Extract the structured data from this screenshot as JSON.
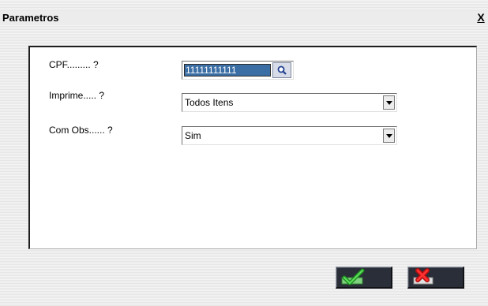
{
  "window": {
    "title": "Parametros",
    "close_glyph": "X"
  },
  "form": {
    "cpf": {
      "label": "CPF......... ?",
      "value": "11111111111"
    },
    "imprime": {
      "label": "Imprime..... ?",
      "selected": "Todos Itens"
    },
    "com_obs": {
      "label": "Com Obs...... ?",
      "selected": "Sim"
    }
  },
  "icons": {
    "lookup": "magnifier-icon",
    "confirm": "checkmark-icon",
    "cancel": "red-x-icon",
    "dropdown": "chevron-down-icon"
  },
  "colors": {
    "selection_bg": "#3b6ea5",
    "confirm_green": "#3fbf3f",
    "cancel_red": "#e21b1b",
    "button_dark": "#2a2e38"
  }
}
